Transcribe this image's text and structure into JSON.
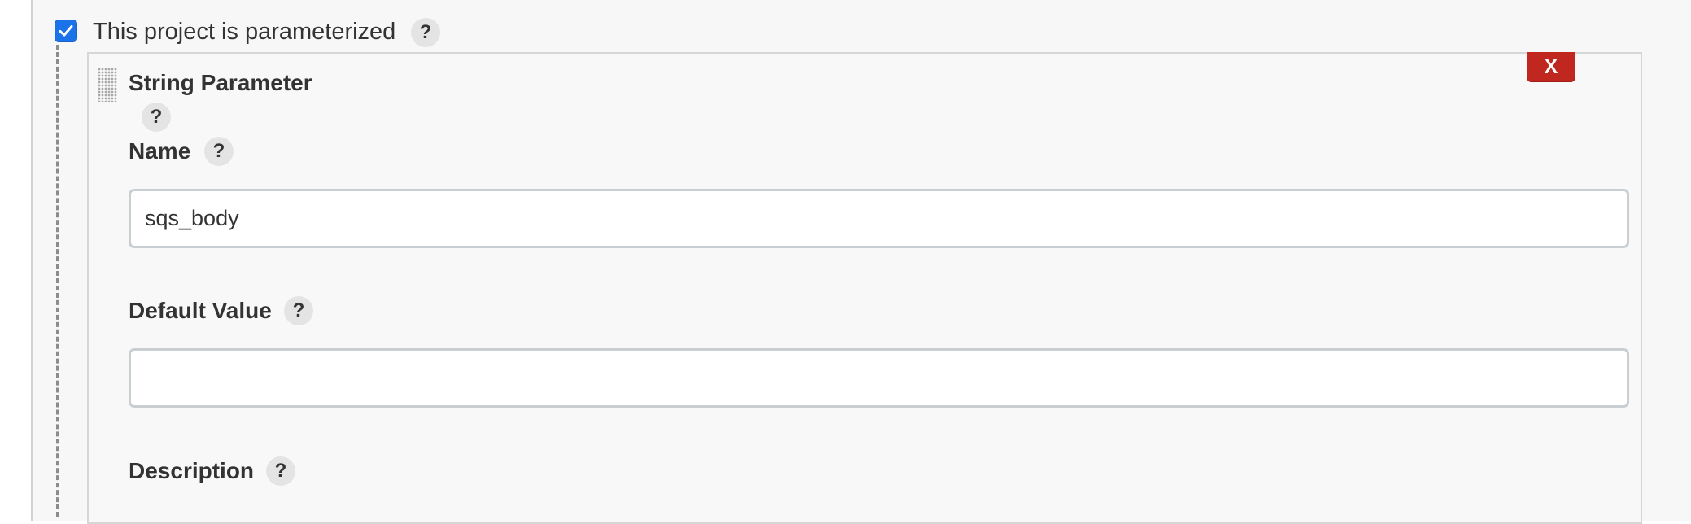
{
  "parameterized": {
    "checkbox_checked": true,
    "label": "This project is parameterized",
    "help": "?"
  },
  "string_parameter": {
    "title": "String Parameter",
    "help": "?",
    "delete_label": "X",
    "name": {
      "label": "Name",
      "help": "?",
      "value": "sqs_body"
    },
    "default_value": {
      "label": "Default Value",
      "help": "?",
      "value": ""
    },
    "description": {
      "label": "Description",
      "help": "?"
    }
  },
  "colors": {
    "checkbox": "#1a73e8",
    "delete_button": "#c0271e",
    "help_bubble": "#e4e4e4"
  },
  "icons": {
    "checkbox": "checkmark-icon",
    "drag": "drag-handle-icon"
  }
}
